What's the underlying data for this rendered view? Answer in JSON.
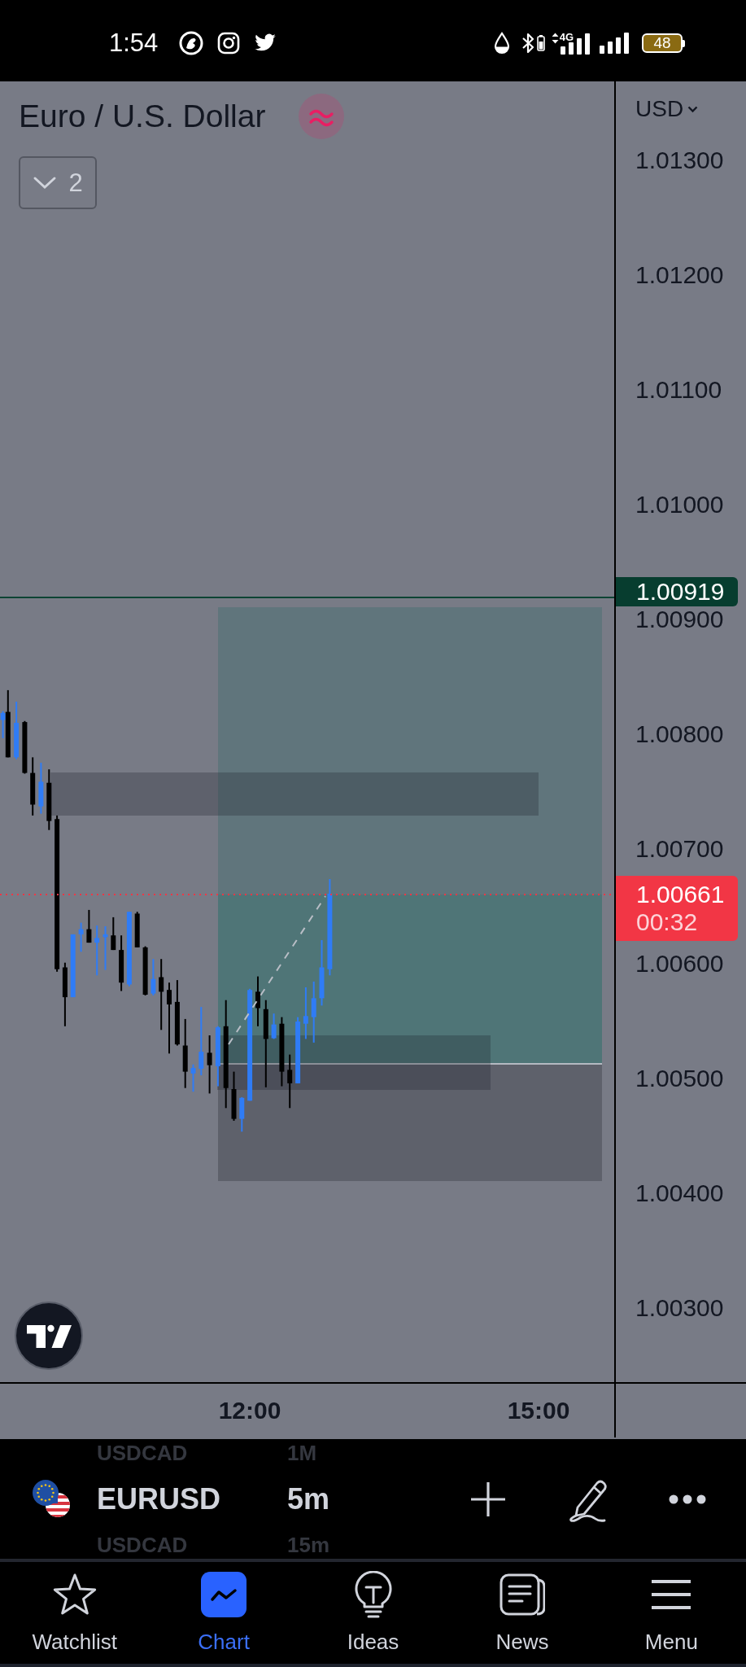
{
  "status_bar": {
    "time": "1:54",
    "network": "4G",
    "battery": "48"
  },
  "chart": {
    "title": "Euro / U.S. Dollar",
    "indicators_count": "2",
    "currency": "USD",
    "price_ticks": [
      "1.01300",
      "1.01200",
      "1.01100",
      "1.01000",
      "1.00900",
      "1.00800",
      "1.00700",
      "1.00600",
      "1.00500",
      "1.00400",
      "1.00300"
    ],
    "price_labels": [
      {
        "kind": "line",
        "price": "1.00919"
      },
      {
        "kind": "last",
        "price": "1.00661",
        "countdown": "00:32"
      }
    ],
    "time_ticks": [
      "12:00",
      "15:00"
    ]
  },
  "symbol_bar": {
    "previous": {
      "symbol": "USDCAD",
      "interval": "1M"
    },
    "symbol": "EURUSD",
    "interval": "5m",
    "next": {
      "symbol": "USDCAD",
      "interval": "15m"
    }
  },
  "nav": [
    {
      "label": "Watchlist",
      "selected": false
    },
    {
      "label": "Chart",
      "selected": true
    },
    {
      "label": "Ideas",
      "selected": false
    },
    {
      "label": "News",
      "selected": false
    },
    {
      "label": "Menu",
      "selected": false
    }
  ]
}
